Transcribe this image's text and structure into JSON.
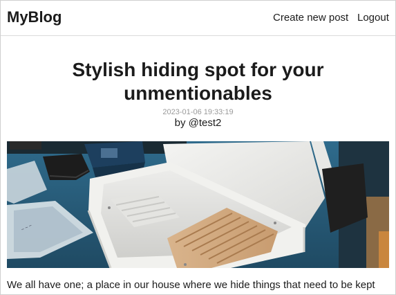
{
  "navbar": {
    "brand": "MyBlog",
    "links": {
      "create": "Create new post",
      "logout": "Logout"
    }
  },
  "post": {
    "title": "Stylish hiding spot for your unmentionables",
    "timestamp": "2023-01-06 19:33:19",
    "author": "by @test2",
    "image_alt": "White wooden storage box with ribbed wooden tray on a display table",
    "body": "We all have one; a place in our house where we hide things that need to be kept out of reach of children. At CES in Las Vegas, one company believes it has a more"
  },
  "colors": {
    "text": "#1b1b1b",
    "muted": "#9a9a9a",
    "divider": "#dadada",
    "table_blue": "#2b5f7c"
  }
}
